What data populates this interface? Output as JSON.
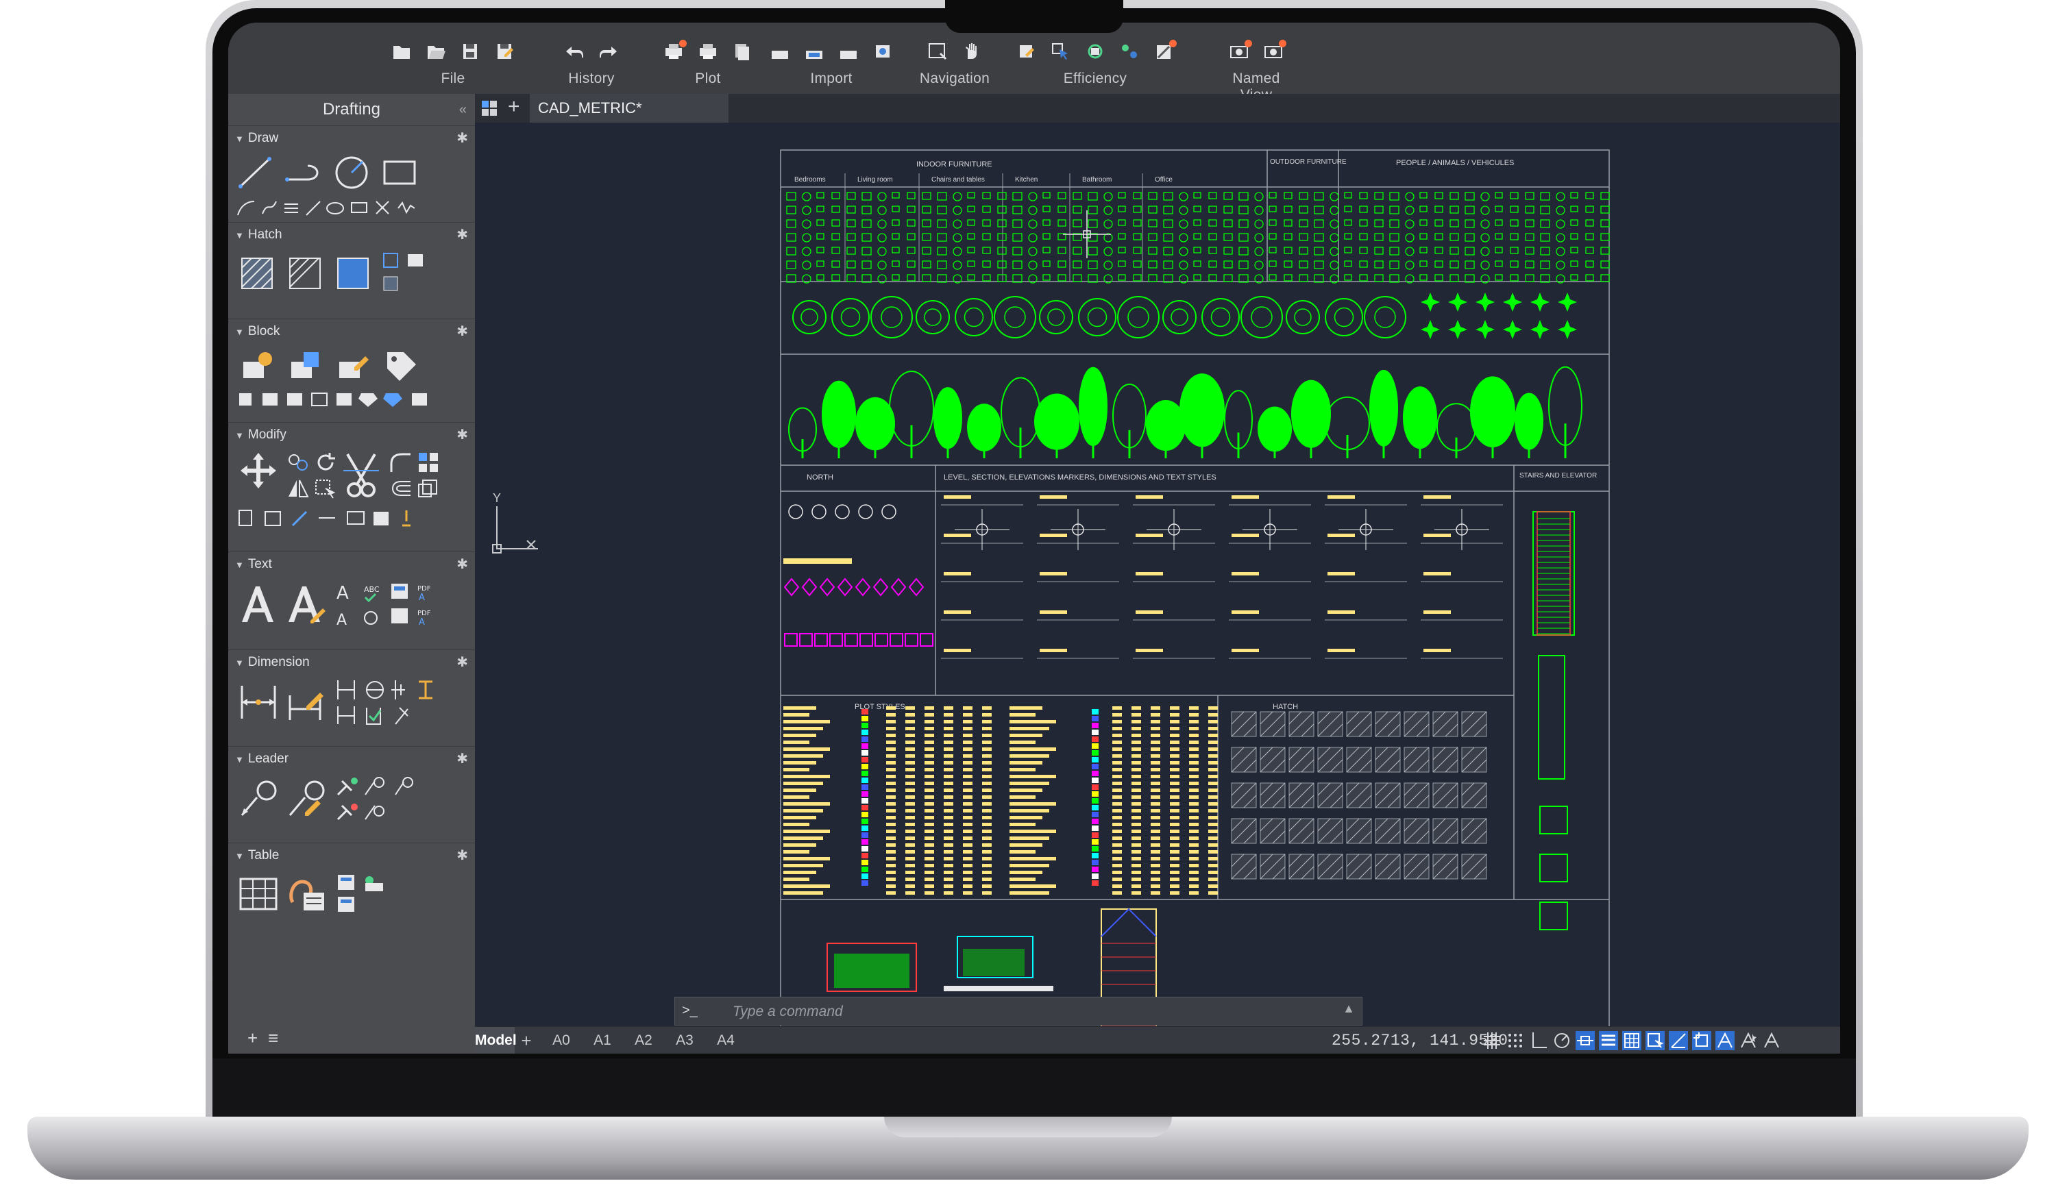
{
  "ribbon": {
    "groups": [
      {
        "label": "File",
        "icons": [
          "new-drawing-icon",
          "open-drawing-icon",
          "save-icon",
          "save-as-icon"
        ]
      },
      {
        "label": "History",
        "icons": [
          "undo-icon",
          "redo-icon"
        ]
      },
      {
        "label": "Plot",
        "icons": [
          "plot-icon",
          "print-icon",
          "page-setup-icon"
        ]
      },
      {
        "label": "Import",
        "icons": [
          "import-icon",
          "attach-icon",
          "import-pdf-icon",
          "import-image-icon"
        ]
      },
      {
        "label": "Navigation",
        "icons": [
          "zoom-window-icon",
          "pan-icon"
        ]
      },
      {
        "label": "Efficiency",
        "icons": [
          "quick-properties-icon",
          "select-similar-icon",
          "refresh-icon",
          "group-icon",
          "purge-icon"
        ]
      },
      {
        "label": "Named View",
        "icons": [
          "new-view-icon",
          "view-manager-icon"
        ]
      }
    ]
  },
  "palette": {
    "title": "Drafting",
    "collapse_glyph": "«",
    "sections": [
      {
        "label": "Draw"
      },
      {
        "label": "Hatch"
      },
      {
        "label": "Block"
      },
      {
        "label": "Modify"
      },
      {
        "label": "Text"
      },
      {
        "label": "Dimension"
      },
      {
        "label": "Leader"
      },
      {
        "label": "Table"
      }
    ],
    "footer_add": "+",
    "footer_menu": "≡"
  },
  "document": {
    "tab_add": "+",
    "tab_name": "CAD_METRIC*"
  },
  "drawing": {
    "indoor_furniture": "INDOOR FURNITURE",
    "outdoor_furniture": "OUTDOOR FURNITURE",
    "people": "PEOPLE / ANIMALS / VEHICULES",
    "cols": [
      "Bedrooms",
      "Living room",
      "Chairs and tables",
      "Kitchen",
      "Bathroom",
      "Office"
    ],
    "north": "NORTH",
    "markers": "LEVEL, SECTION, ELEVATIONS MARKERS, DIMENSIONS AND TEXT STYLES",
    "stairs": "STAIRS AND ELEVATOR",
    "plot_styles": "PLOT STYLES",
    "hatch": "HATCH",
    "ucs_y": "Y"
  },
  "command": {
    "prompt": ">_",
    "placeholder": "Type a command",
    "expand_glyph": "▲"
  },
  "status": {
    "model_tab": "Model",
    "add_layout": "+",
    "layouts": [
      "A0",
      "A1",
      "A2",
      "A3",
      "A4"
    ],
    "coords": "255.2713, 141.9530"
  },
  "colors": {
    "canvas": "#212734",
    "cad_green": "#00ff00",
    "cad_yellow": "#ffe680",
    "cad_magenta": "#ff00ff",
    "status_active_blue": "#2e6fd1"
  }
}
